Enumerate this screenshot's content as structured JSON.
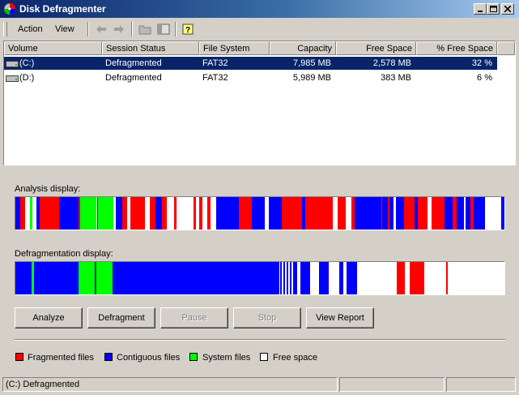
{
  "window": {
    "title": "Disk Defragmenter"
  },
  "menu": {
    "action": "Action",
    "view": "View"
  },
  "list": {
    "columns": [
      "Volume",
      "Session Status",
      "File System",
      "Capacity",
      "Free Space",
      "% Free Space"
    ],
    "rows": [
      {
        "volume": "(C:)",
        "status": "Defragmented",
        "fs": "FAT32",
        "capacity": "7,985 MB",
        "free": "2,578 MB",
        "pct": "32 %",
        "selected": true
      },
      {
        "volume": "(D:)",
        "status": "Defragmented",
        "fs": "FAT32",
        "capacity": "5,989 MB",
        "free": "383 MB",
        "pct": "6 %",
        "selected": false
      }
    ]
  },
  "analysis": {
    "label": "Analysis display:"
  },
  "defrag": {
    "label": "Defragmentation display:"
  },
  "buttons": {
    "analyze": "Analyze",
    "defragment": "Defragment",
    "pause": "Pause",
    "stop": "Stop",
    "report": "View Report"
  },
  "legend": {
    "fragmented": "Fragmented files",
    "contiguous": "Contiguous files",
    "system": "System files",
    "free": "Free space"
  },
  "colors": {
    "fragmented": "#ff0000",
    "contiguous": "#0000ff",
    "system": "#00ff00",
    "free": "#ffffff"
  },
  "status": {
    "text": "(C:) Defragmented"
  }
}
